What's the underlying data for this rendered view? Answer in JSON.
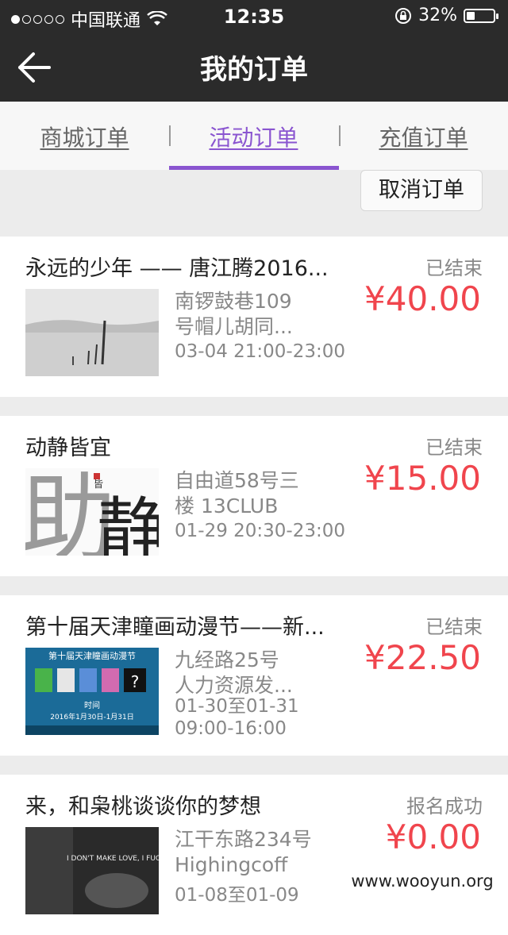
{
  "status_bar": {
    "carrier": "中国联通",
    "time": "12:35",
    "battery": "32%",
    "battery_level": 0.32,
    "icons": [
      "wifi-icon",
      "rotation-lock-icon",
      "battery-icon"
    ]
  },
  "header": {
    "title": "我的订单",
    "back_icon": "back-arrow-icon"
  },
  "tabs": [
    {
      "label": "商城订单",
      "active": false
    },
    {
      "label": "活动订单",
      "active": true
    },
    {
      "label": "充值订单",
      "active": false
    }
  ],
  "cancel_button": "取消订单",
  "orders": [
    {
      "title": "永远的少年 —— 唐江腾2016...",
      "status": "已结束",
      "address": "南锣鼓巷109 号帽儿胡同...",
      "address_lines": [
        "南锣鼓巷109",
        "号帽儿胡同..."
      ],
      "time": "03-04 21:00-23:00",
      "price": "¥40.00"
    },
    {
      "title": "动静皆宜",
      "status": "已结束",
      "address_lines": [
        "自由道58号三",
        "楼  13CLUB"
      ],
      "time": "01-29 20:30-23:00",
      "price": "¥15.00"
    },
    {
      "title": "第十届天津瞳画动漫节——新...",
      "status": "已结束",
      "address_lines": [
        "九经路25号",
        "人力资源发..."
      ],
      "time_lines": [
        "01-30至01-31",
        "09:00-16:00"
      ],
      "price": "¥22.50"
    },
    {
      "title": "来，和枭桃谈谈你的梦想",
      "status": "报名成功",
      "address_lines": [
        "江干东路234号",
        "Highingcoff"
      ],
      "time_lines": [
        "01-08至01-09"
      ],
      "price": "¥0.00"
    }
  ],
  "thumbnail_text": {
    "order2_logo": "皆",
    "order3_banner": "第十届天津瞳画动漫节",
    "order3_time_label": "时间",
    "order3_date": "2016年1月30日-1月31日",
    "order4_text": "I DON'T MAKE LOVE, I FUCK, HARD."
  },
  "watermark": "www.wooyun.org",
  "colors": {
    "accent": "#8a55d0",
    "price": "#f0454d",
    "header_bg": "#2b2b2b"
  }
}
